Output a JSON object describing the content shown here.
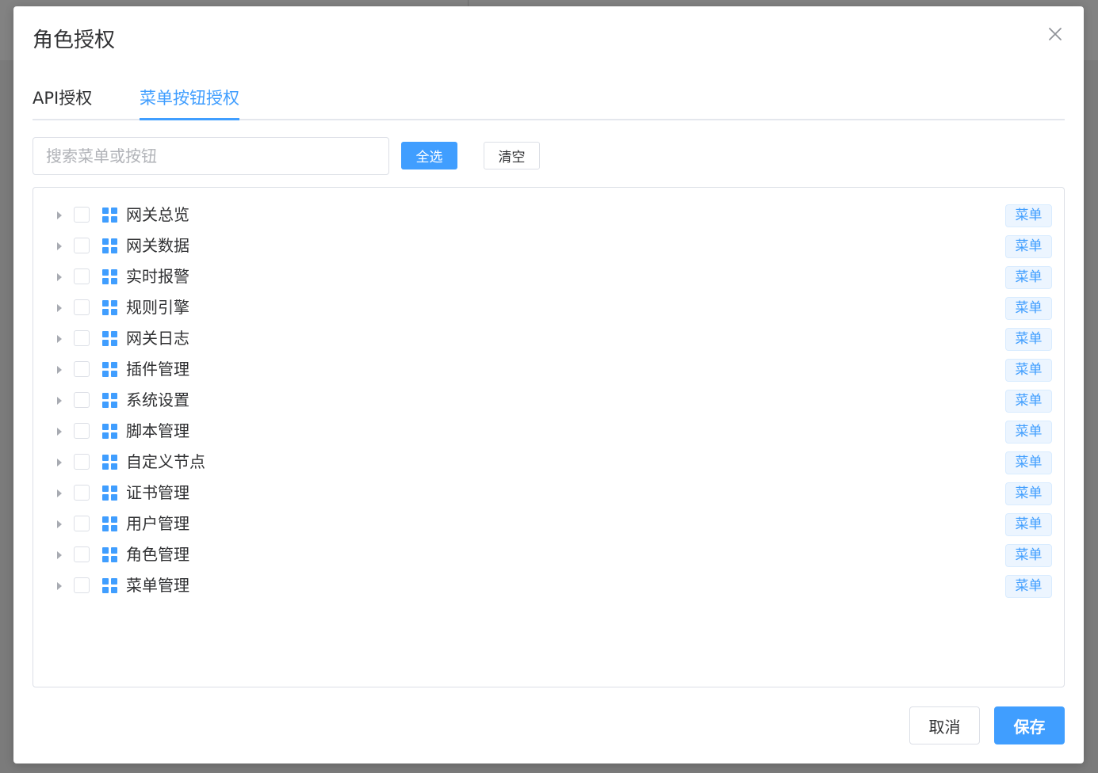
{
  "dialog": {
    "title": "角色授权",
    "close_icon": "close-icon"
  },
  "tabs": [
    {
      "label": "API授权",
      "active": false
    },
    {
      "label": "菜单按钮授权",
      "active": true
    }
  ],
  "toolbar": {
    "search_placeholder": "搜索菜单或按钮",
    "search_value": "",
    "select_all_label": "全选",
    "clear_label": "清空"
  },
  "tree": {
    "node_icon": "grid-icon",
    "expand_icon": "caret-right-icon",
    "items": [
      {
        "label": "网关总览",
        "tag": "菜单",
        "checked": false
      },
      {
        "label": "网关数据",
        "tag": "菜单",
        "checked": false
      },
      {
        "label": "实时报警",
        "tag": "菜单",
        "checked": false
      },
      {
        "label": "规则引擎",
        "tag": "菜单",
        "checked": false
      },
      {
        "label": "网关日志",
        "tag": "菜单",
        "checked": false
      },
      {
        "label": "插件管理",
        "tag": "菜单",
        "checked": false
      },
      {
        "label": "系统设置",
        "tag": "菜单",
        "checked": false
      },
      {
        "label": "脚本管理",
        "tag": "菜单",
        "checked": false
      },
      {
        "label": "自定义节点",
        "tag": "菜单",
        "checked": false
      },
      {
        "label": "证书管理",
        "tag": "菜单",
        "checked": false
      },
      {
        "label": "用户管理",
        "tag": "菜单",
        "checked": false
      },
      {
        "label": "角色管理",
        "tag": "菜单",
        "checked": false
      },
      {
        "label": "菜单管理",
        "tag": "菜单",
        "checked": false
      }
    ]
  },
  "footer": {
    "cancel_label": "取消",
    "save_label": "保存"
  },
  "colors": {
    "primary": "#409eff",
    "text": "#303133",
    "border": "#dcdfe6",
    "overlay": "#7b7b7b"
  }
}
